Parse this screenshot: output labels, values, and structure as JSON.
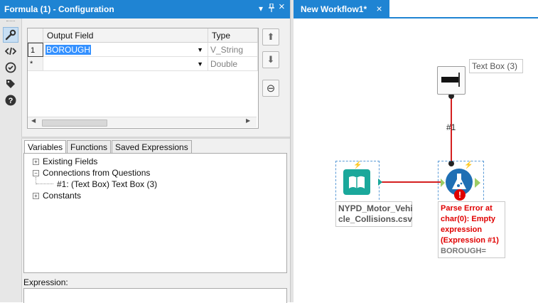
{
  "config_panel": {
    "title": "Formula (1) - Configuration",
    "controls": {
      "dropdown": "▾",
      "pin": "📌",
      "close": "×"
    }
  },
  "grid": {
    "headers": [
      "Output Field",
      "Type"
    ],
    "rows": [
      {
        "num": "1",
        "field": "BOROUGH",
        "type": "V_String"
      },
      {
        "num": "*",
        "field": "",
        "type": "Double"
      }
    ]
  },
  "side_buttons": {
    "up": "⬆",
    "down": "⬇",
    "delete": "⊖"
  },
  "tabs": [
    "Variables",
    "Functions",
    "Saved Expressions"
  ],
  "tree": {
    "existing_fields": "Existing Fields",
    "connections": "Connections from Questions",
    "connection_item": "#1: (Text Box) Text Box (3)",
    "constants": "Constants"
  },
  "expression_label": "Expression:",
  "canvas": {
    "tab": "New Workflow1*",
    "tab_close": "×",
    "textbox_label": "Text Box (3)",
    "connection_label": "#1",
    "input_label_line1": "NYPD_Motor_Vehi",
    "input_label_line2": "cle_Collisions.csv",
    "error_lines": [
      "Parse Error at",
      "char(0): Empty",
      "expression",
      "(Expression #1)"
    ],
    "formula_expr": "BOROUGH="
  },
  "colors": {
    "accent": "#1f84d3",
    "input_tool": "#1aa89b",
    "formula_tool": "#1f6fb4",
    "error": "#e00000",
    "connector": "#d52020"
  }
}
